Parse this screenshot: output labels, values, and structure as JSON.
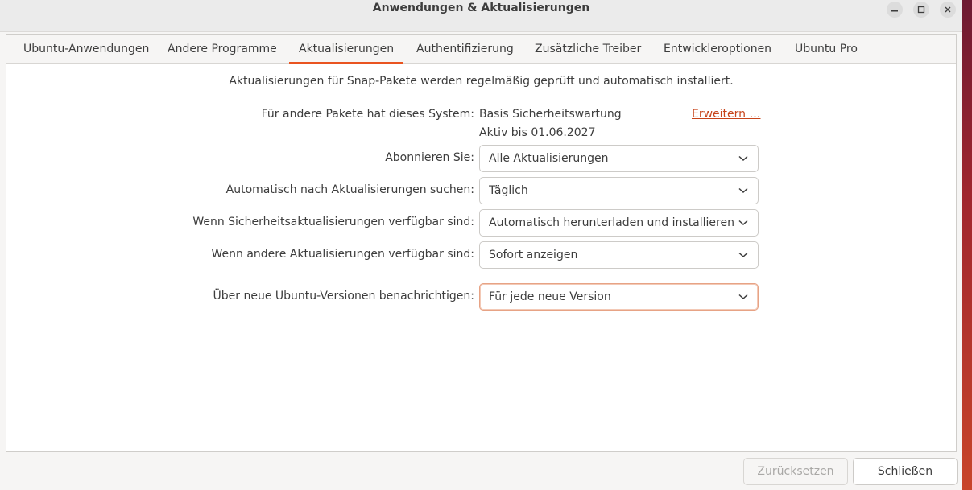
{
  "window": {
    "title": "Anwendungen & Aktualisierungen",
    "buttons": {
      "minimize": "–",
      "maximize": "□",
      "close": "×"
    }
  },
  "tabs": [
    {
      "label": "Ubuntu-Anwendungen",
      "active": false
    },
    {
      "label": "Andere Programme",
      "active": false
    },
    {
      "label": "Aktualisierungen",
      "active": true
    },
    {
      "label": "Authentifizierung",
      "active": false
    },
    {
      "label": "Zusätzliche Treiber",
      "active": false
    },
    {
      "label": "Entwickleroptionen",
      "active": false
    },
    {
      "label": "Ubuntu Pro",
      "active": false
    }
  ],
  "updates": {
    "snap_info": "Aktualisierungen für Snap-Pakete werden regelmäßig geprüft und automatisch installiert.",
    "support_label": "Für andere Pakete hat dieses System:",
    "support_value": "Basis Sicherheitswartung",
    "support_until": "Aktiv bis 01.06.2027",
    "extend_link": "Erweitern …",
    "subscribe_label": "Abonnieren Sie:",
    "subscribe_value": "Alle Aktualisierungen",
    "check_label": "Automatisch nach Aktualisierungen suchen:",
    "check_value": "Täglich",
    "security_label": "Wenn Sicherheitsaktualisierungen verfügbar sind:",
    "security_value": "Automatisch herunterladen und installieren",
    "other_label": "Wenn andere Aktualisierungen verfügbar sind:",
    "other_value": "Sofort anzeigen",
    "notify_label": "Über neue Ubuntu-Versionen benachrichtigen:",
    "notify_value": "Für jede neue Version"
  },
  "footer": {
    "reset_label": "Zurücksetzen",
    "close_label": "Schließen"
  },
  "colors": {
    "accent": "#e95420",
    "link": "#c7441a"
  },
  "icons": {
    "dropdown": "chevron-down-icon"
  }
}
